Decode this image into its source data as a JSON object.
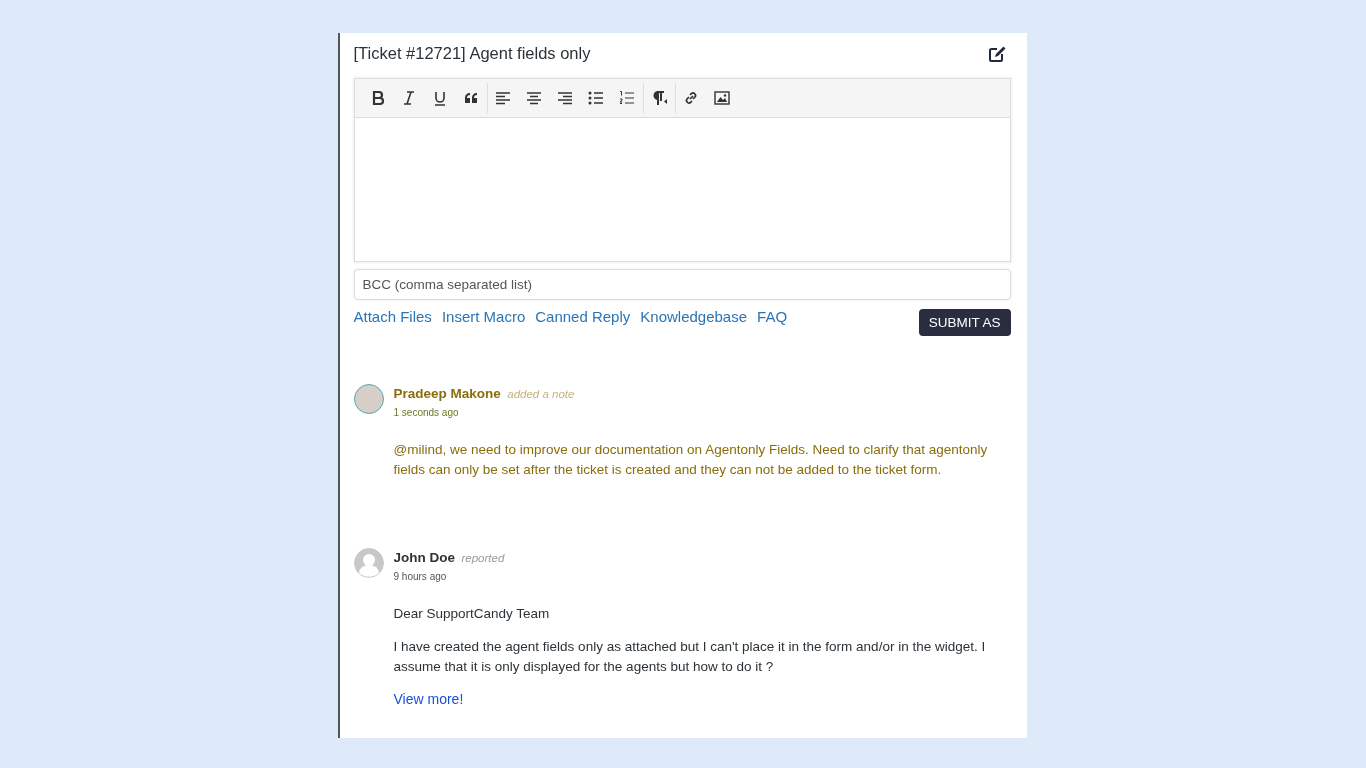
{
  "ticket": {
    "title": "[Ticket #12721] Agent fields only"
  },
  "toolbar": [
    {
      "kind": "bold"
    },
    {
      "kind": "italic"
    },
    {
      "kind": "underline"
    },
    {
      "kind": "quote"
    },
    {
      "kind": "separator"
    },
    {
      "kind": "align-left"
    },
    {
      "kind": "align-center"
    },
    {
      "kind": "align-right"
    },
    {
      "kind": "bullet-list"
    },
    {
      "kind": "numbered-list"
    },
    {
      "kind": "separator"
    },
    {
      "kind": "paragraph-direction"
    },
    {
      "kind": "separator"
    },
    {
      "kind": "link"
    },
    {
      "kind": "image"
    }
  ],
  "bcc": {
    "placeholder": "BCC (comma separated list)"
  },
  "actions": [
    "Attach Files",
    "Insert Macro",
    "Canned Reply",
    "Knowledgebase",
    "FAQ"
  ],
  "submit": {
    "label": "SUBMIT AS"
  },
  "threads": [
    {
      "kind": "note",
      "author": "Pradeep Makone",
      "action": "added a note",
      "time": "1 seconds ago",
      "paragraphs": [
        "@milind, we need to improve our documentation on Agentonly Fields. Need to clarify that agentonly fields can only be set after the ticket is created and they can not be added to the ticket form."
      ]
    },
    {
      "kind": "reply",
      "author": "John Doe",
      "action": "reported",
      "time": "9 hours ago",
      "paragraphs": [
        "Dear SupportCandy Team",
        "I have created the agent fields only as attached but I can't place it in the form and/or in the widget. I assume that it is only displayed for the agents but how to do it ?"
      ],
      "link": "View more!"
    }
  ]
}
